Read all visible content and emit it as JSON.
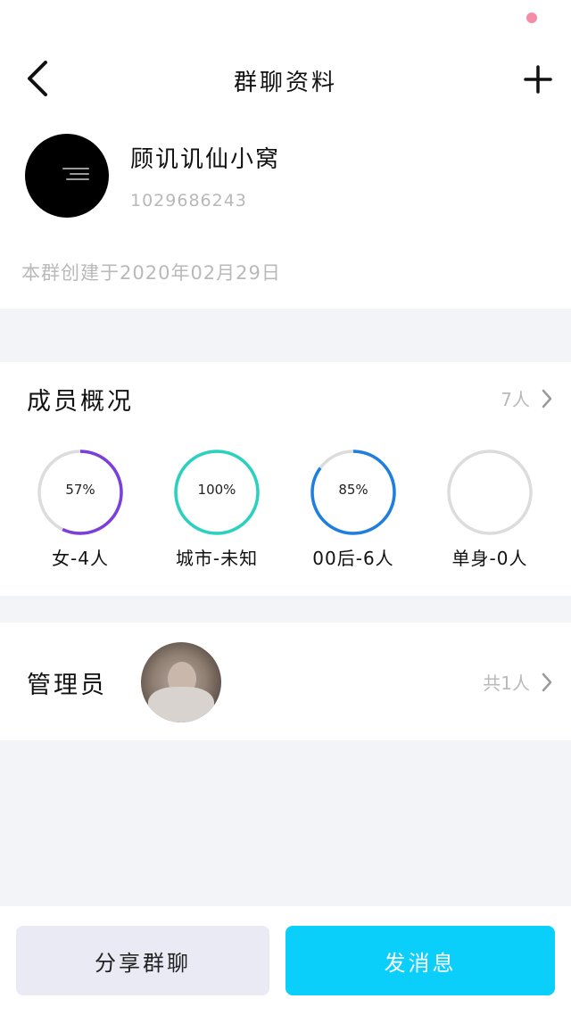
{
  "header": {
    "title": "群聊资料",
    "back_icon": "chevron-left-icon",
    "add_icon": "plus-icon"
  },
  "group": {
    "name": "顾讥讥仙小窝",
    "id": "1029686243",
    "created": "本群创建于2020年02月29日"
  },
  "members": {
    "title": "成员概况",
    "count": "7人",
    "stats": [
      {
        "label": "女-4人",
        "percent_text": "57%",
        "progress": 0.57,
        "color": "#7b3fdc"
      },
      {
        "label": "城市-未知",
        "percent_text": "100%",
        "progress": 1.0,
        "color": "#2bd1bf"
      },
      {
        "label": "00后-6人",
        "percent_text": "85%",
        "progress": 0.85,
        "color": "#1f7fe0"
      },
      {
        "label": "单身-0人",
        "percent_text": "",
        "progress": 0,
        "color": "#dddddd"
      }
    ]
  },
  "admins": {
    "title": "管理员",
    "count": "共1人"
  },
  "footer": {
    "share_label": "分享群聊",
    "send_label": "发消息"
  },
  "colors": {
    "accent": "#0bcffb",
    "track": "#dcdcdc",
    "muted_text": "#b9b9b9"
  }
}
